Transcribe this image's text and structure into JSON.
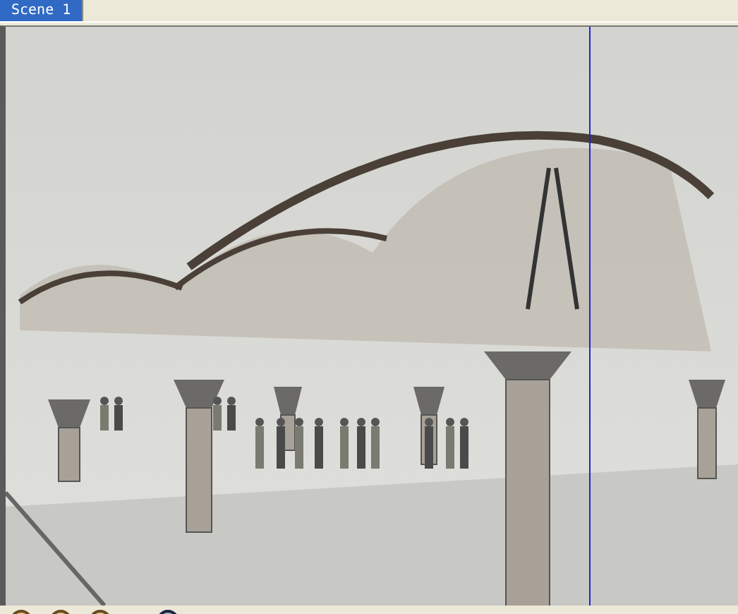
{
  "tabs": [
    {
      "label": "Scene 1",
      "selected": true
    }
  ]
}
